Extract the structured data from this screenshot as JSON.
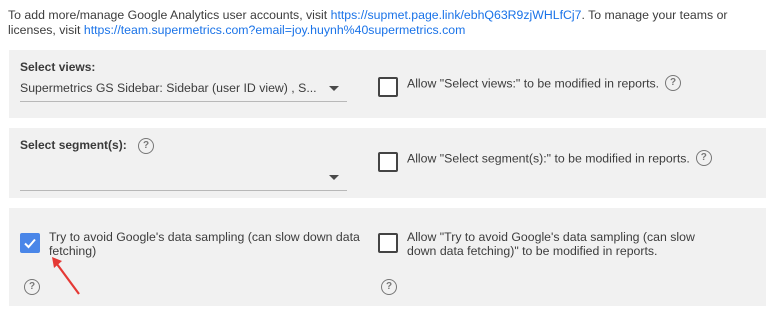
{
  "intro": {
    "text1": "To add more/manage Google Analytics user accounts, visit ",
    "link1": "https://supmet.page.link/ebhQ63R9zjWHLfCj7",
    "text2": ". To manage your teams or licenses, visit ",
    "link2": "https://team.supermetrics.com?email=joy.huynh%40supermetrics.com"
  },
  "views": {
    "label": "Select views:",
    "value": "Supermetrics GS Sidebar: Sidebar (user ID view) , S...",
    "allow_text": "Allow \"Select views:\" to be modified in reports.",
    "allow_checked": false
  },
  "segments": {
    "label": "Select segment(s):",
    "value": "",
    "allow_text": "Allow \"Select segment(s):\" to be modified in reports.",
    "allow_checked": false
  },
  "sampling": {
    "label": "Try to avoid Google's data sampling (can slow down data fetching)",
    "checked": true,
    "allow_text": "Allow \"Try to avoid Google's data sampling (can slow down data fetching)\" to be modified in reports.",
    "allow_checked": false
  },
  "help_glyph": "?",
  "colors": {
    "link": "#1a73e8",
    "checked": "#4a86e8",
    "arrow": "#e53935",
    "panel": "#f1f1f1"
  }
}
